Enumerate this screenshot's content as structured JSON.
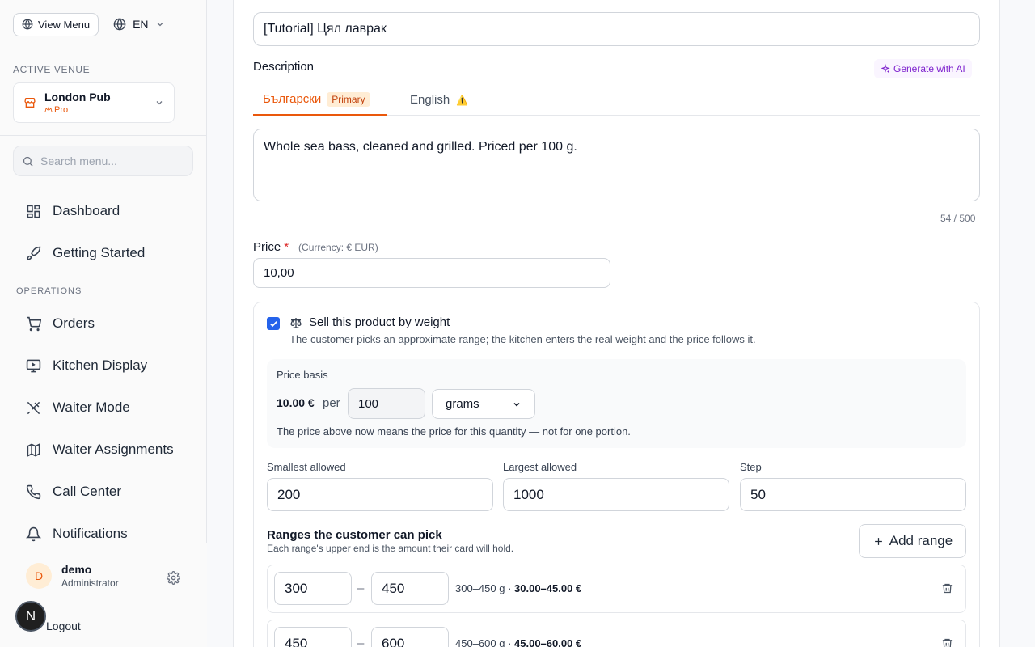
{
  "sidebar": {
    "view_menu_label": "View Menu",
    "language": "EN",
    "active_venue_label": "ACTIVE VENUE",
    "venue_name": "London Pub",
    "venue_tier": "Pro",
    "search_placeholder": "Search menu...",
    "nav_top": [
      {
        "label": "Dashboard",
        "icon": "dashboard-icon"
      },
      {
        "label": "Getting Started",
        "icon": "rocket-icon"
      }
    ],
    "operations_label": "OPERATIONS",
    "nav_ops": [
      {
        "label": "Orders",
        "icon": "cart-icon"
      },
      {
        "label": "Kitchen Display",
        "icon": "monitor-icon"
      },
      {
        "label": "Waiter Mode",
        "icon": "utensils-icon"
      },
      {
        "label": "Waiter Assignments",
        "icon": "map-icon"
      },
      {
        "label": "Call Center",
        "icon": "phone-icon"
      },
      {
        "label": "Notifications",
        "icon": "bell-icon"
      }
    ],
    "user": {
      "initial": "D",
      "name": "demo",
      "role": "Administrator"
    },
    "logout_label": "Logout",
    "badge_letter": "N"
  },
  "form": {
    "title_value": "[Tutorial] Цял лаврак",
    "description_label": "Description",
    "generate_ai_label": "Generate with AI",
    "tabs": [
      {
        "label": "Български",
        "badge": "Primary"
      },
      {
        "label": "English",
        "warning": "⚠️"
      }
    ],
    "description_value": "Whole sea bass, cleaned and grilled. Priced per 100 g.",
    "char_counter": "54 / 500",
    "price_label": "Price",
    "required_mark": "*",
    "currency_note": "(Currency: € EUR)",
    "price_value": "10,00"
  },
  "weight": {
    "checkbox_checked": true,
    "title": "Sell this product by weight",
    "subtitle": "The customer picks an approximate range; the kitchen enters the real weight and the price follows it.",
    "basis_label": "Price basis",
    "basis_price": "10.00 €",
    "per_label": "per",
    "basis_qty": "100",
    "basis_unit": "grams",
    "basis_note": "The price above now means the price for this quantity — not for one portion.",
    "smallest_label": "Smallest allowed",
    "smallest_value": "200",
    "largest_label": "Largest allowed",
    "largest_value": "1000",
    "step_label": "Step",
    "step_value": "50",
    "ranges_title": "Ranges the customer can pick",
    "ranges_sub": "Each range's upper end is the amount their card will hold.",
    "add_range_label": "Add range",
    "ranges": [
      {
        "from": "300",
        "to": "450",
        "summary": "300–450 g · ",
        "price": "30.00–45.00 €"
      },
      {
        "from": "450",
        "to": "600",
        "summary": "450–600 g · ",
        "price": "45.00–60.00 €"
      }
    ],
    "dash": "–"
  },
  "colors": {
    "accent": "#ea580c",
    "checkbox": "#2563eb",
    "ai": "#7e22ce"
  }
}
